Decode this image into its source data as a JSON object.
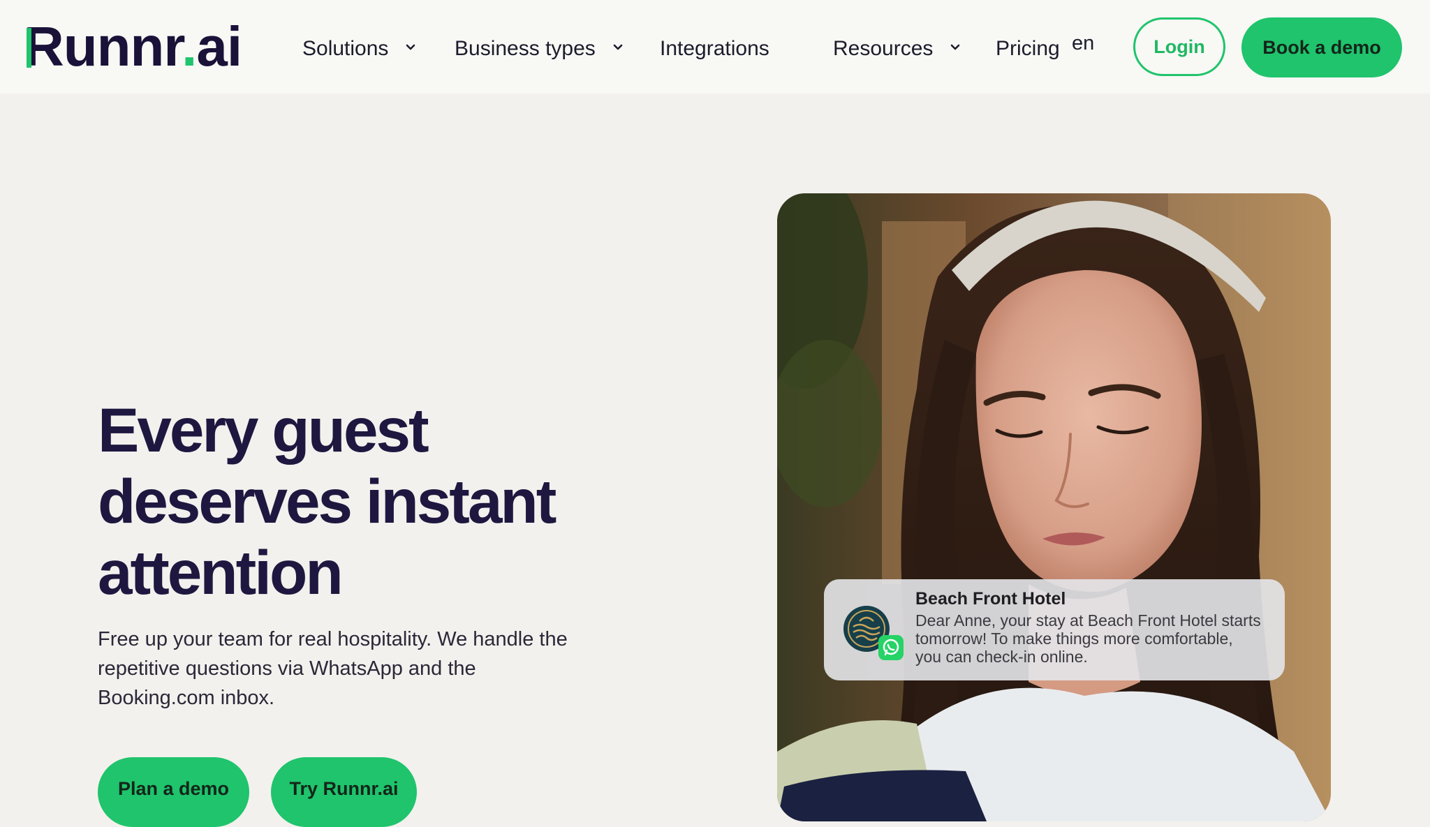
{
  "header": {
    "logo": {
      "main": "Runnr",
      "dot": ".",
      "suffix": "ai"
    },
    "nav": [
      {
        "label": "Solutions",
        "has_dropdown": true
      },
      {
        "label": "Business types",
        "has_dropdown": true
      },
      {
        "label": "Integrations",
        "has_dropdown": false
      },
      {
        "label": "Resources",
        "has_dropdown": true
      },
      {
        "label": "Pricing",
        "has_dropdown": false
      }
    ],
    "language": "en",
    "login_label": "Login",
    "book_demo_label": "Book a demo"
  },
  "hero": {
    "title_lines": [
      "Every guest",
      "deserves instant",
      "attention"
    ],
    "subtitle_lines": [
      "Free up your team for real hospitality. We handle the",
      "repetitive questions via WhatsApp and the",
      "Booking.com inbox."
    ],
    "cta_primary": "Plan a demo",
    "cta_secondary": "Try Runnr.ai"
  },
  "notification": {
    "title": "Beach Front Hotel",
    "body_lines": [
      "Dear Anne, your stay at Beach Front Hotel starts",
      "tomorrow! To make things more comfortable,",
      "you can check-in online."
    ],
    "app_icon": "whatsapp-icon"
  },
  "colors": {
    "brand_green": "#1fc46c",
    "brand_navy": "#1e1840",
    "page_background": "#f3f1ed"
  }
}
